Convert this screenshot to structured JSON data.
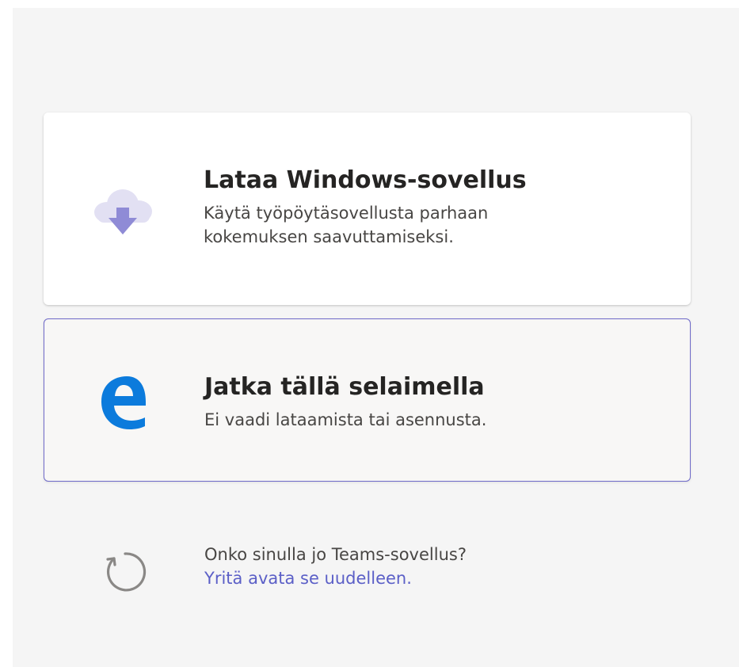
{
  "download_option": {
    "title": "Lataa Windows-sovellus",
    "description": "Käytä työpöytäsovellusta parhaan kokemuksen saavuttamiseksi.",
    "icon": "cloud-download-icon"
  },
  "browser_option": {
    "title": "Jatka tällä selaimella",
    "description": "Ei vaadi lataamista tai asennusta.",
    "icon": "edge-browser-icon"
  },
  "retry": {
    "question": "Onko sinulla jo Teams-sovellus?",
    "link": "Yritä avata se uudelleen.",
    "icon": "refresh-icon"
  },
  "colors": {
    "accent": "#6f6ac9",
    "link": "#5b5fc7",
    "cloud": "#e2e0f3",
    "arrow": "#8f8bd6",
    "edge": "#0c7bdc"
  }
}
